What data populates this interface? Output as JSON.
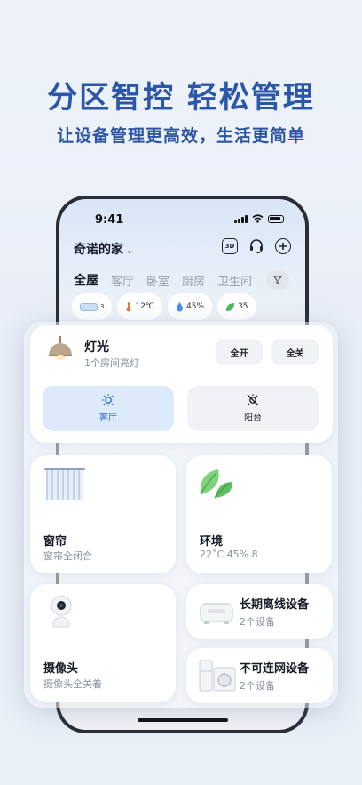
{
  "hero": {
    "headline": "分区智控 轻松管理",
    "subline": "让设备管理更高效，生活更简单"
  },
  "phone": {
    "status_time": "9:41",
    "home_name": "奇诺的家",
    "home_chevron": "⌄",
    "top_icons": [
      "3d-icon",
      "headset-icon",
      "add-icon"
    ],
    "three_d_label": "3D",
    "tabs": [
      "全屋",
      "客厅",
      "卧室",
      "厨房",
      "卫生间"
    ],
    "chips": [
      {
        "icon": "air-conditioner-icon",
        "value": "3"
      },
      {
        "icon": "thermometer-icon",
        "value": "12℃"
      },
      {
        "icon": "humidity-icon",
        "value": "45%"
      },
      {
        "icon": "leaf-icon",
        "value": "35"
      }
    ]
  },
  "light": {
    "title": "灯光",
    "subtitle": "1个房间亮灯",
    "all_on": "全开",
    "all_off": "全关",
    "rooms": [
      {
        "label": "客厅",
        "icon": "bulb-on-icon",
        "active": true
      },
      {
        "label": "阳台",
        "icon": "bulb-off-icon",
        "active": false
      }
    ]
  },
  "tiles": {
    "curtain": {
      "title": "窗帘",
      "subtitle": "窗帘全闭合"
    },
    "environment": {
      "title": "环境",
      "subtitle": "22˚C 45% 8"
    },
    "camera": {
      "title": "摄像头",
      "subtitle": "摄像头全关着"
    },
    "offline": {
      "title": "长期离线设备",
      "subtitle": "2个设备"
    },
    "unconnectable": {
      "title": "不可连网设备",
      "subtitle": "2个设备"
    }
  },
  "colors": {
    "headline": "#2c56a8",
    "active_room_bg": "#ddeafc",
    "active_room_text": "#2d6bd6",
    "leaf_green": "#5cbf64"
  }
}
